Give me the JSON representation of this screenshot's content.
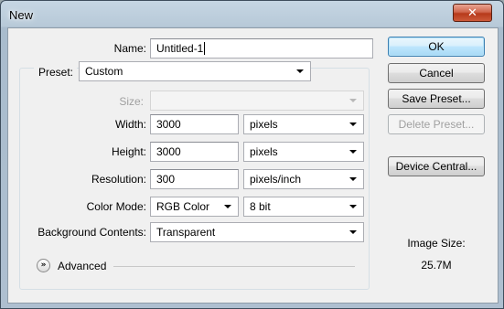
{
  "window": {
    "title": "New",
    "close_glyph": "✕"
  },
  "name": {
    "label": "Name:",
    "value": "Untitled-1"
  },
  "preset": {
    "label": "Preset:",
    "value": "Custom"
  },
  "size": {
    "label": "Size:",
    "value": ""
  },
  "width": {
    "label": "Width:",
    "value": "3000",
    "unit": "pixels"
  },
  "height": {
    "label": "Height:",
    "value": "3000",
    "unit": "pixels"
  },
  "resolution": {
    "label": "Resolution:",
    "value": "300",
    "unit": "pixels/inch"
  },
  "color_mode": {
    "label": "Color Mode:",
    "value": "RGB Color",
    "depth": "8 bit"
  },
  "background": {
    "label": "Background Contents:",
    "value": "Transparent"
  },
  "advanced": {
    "label": "Advanced",
    "icon": "double-chevron-down-icon"
  },
  "buttons": {
    "ok": "OK",
    "cancel": "Cancel",
    "save_preset": "Save Preset...",
    "delete_preset": "Delete Preset...",
    "device_central": "Device Central..."
  },
  "image_size": {
    "label": "Image Size:",
    "value": "25.7M"
  },
  "colors": {
    "accent_border": "#3c7fb1",
    "close_red": "#c4452a"
  }
}
